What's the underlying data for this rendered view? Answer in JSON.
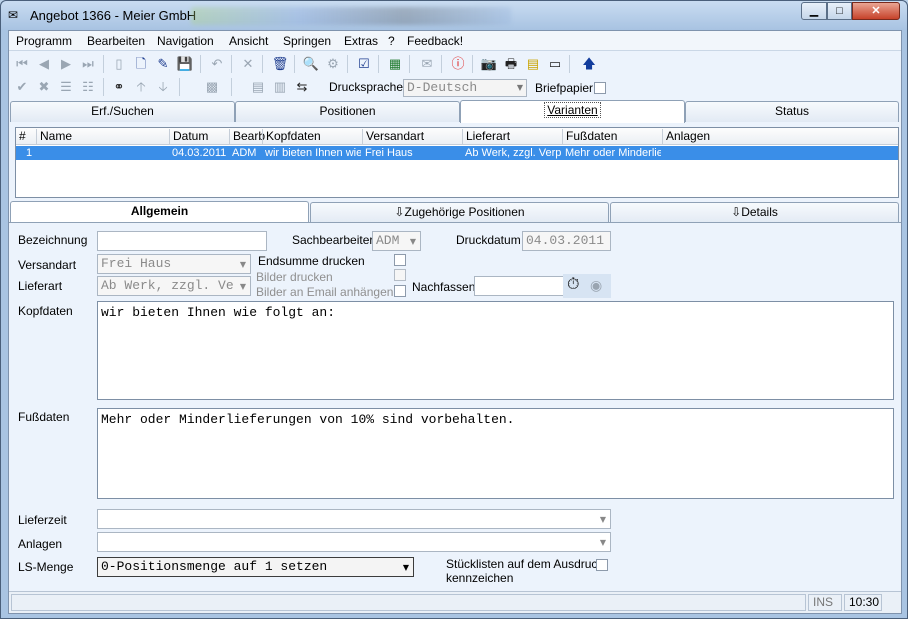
{
  "window": {
    "title": "Angebot 1366 - Meier GmbH"
  },
  "menu": [
    {
      "label": "Programm"
    },
    {
      "label": "Bearbeiten"
    },
    {
      "label": "Navigation"
    },
    {
      "label": "Ansicht"
    },
    {
      "label": "Springen"
    },
    {
      "label": "Extras"
    },
    {
      "label": "?"
    },
    {
      "label": "Feedback!"
    }
  ],
  "toolbar": {
    "druck_label": "Drucksprache",
    "druck_value": "D-Deutsch",
    "briefpapier_label": "Briefpapier"
  },
  "tabs_top": [
    {
      "label": "Erf./Suchen"
    },
    {
      "label": "Positionen"
    },
    {
      "label": "Varianten"
    },
    {
      "label": "Status"
    }
  ],
  "grid": {
    "columns": [
      "#",
      "Name",
      "Datum",
      "Bearb",
      "Kopfdaten",
      "Versandart",
      "Lieferart",
      "Fußdaten",
      "Anlagen"
    ],
    "rows": [
      [
        "1",
        "",
        "04.03.2011",
        "ADM",
        "wir bieten Ihnen wie",
        "Frei Haus",
        "Ab Werk, zzgl. Verp",
        "Mehr oder Minderlie",
        ""
      ]
    ]
  },
  "tabs_low": [
    {
      "label": "Allgemein"
    },
    {
      "label": "Zugehörige Positionen"
    },
    {
      "label": "Details"
    }
  ],
  "form": {
    "bezeichnung_label": "Bezeichnung",
    "bezeichnung_value": "",
    "sachbearbeiter_label": "Sachbearbeiter",
    "sachbearbeiter_value": "ADM",
    "druckdatum_label": "Druckdatum",
    "druckdatum_value": "04.03.2011",
    "versandart_label": "Versandart",
    "versandart_value": "Frei Haus",
    "endsumme_label": "Endsumme drucken",
    "bilder_label": "Bilder drucken",
    "bilder_email_label": "Bilder an Email anhängen",
    "lieferart_label": "Lieferart",
    "lieferart_value": "Ab Werk, zzgl. Ve",
    "nachfassen_label": "Nachfassen",
    "nachfassen_value": "",
    "kopfdaten_label": "Kopfdaten",
    "kopfdaten_value": "wir bieten Ihnen wie folgt an:",
    "fussdaten_label": "Fußdaten",
    "fussdaten_value": "Mehr oder Minderlieferungen von 10% sind vorbehalten.",
    "lieferzeit_label": "Lieferzeit",
    "lieferzeit_value": "",
    "anlagen_label": "Anlagen",
    "anlagen_value": "",
    "lsmenge_label": "LS-Menge",
    "lsmenge_value": "0-Positionsmenge auf 1 setzen",
    "stueckliste_label_1": "Stücklisten auf dem Ausdruck",
    "stueckliste_label_2": "kennzeichen"
  },
  "status": {
    "mode": "INS",
    "time": "10:30"
  }
}
